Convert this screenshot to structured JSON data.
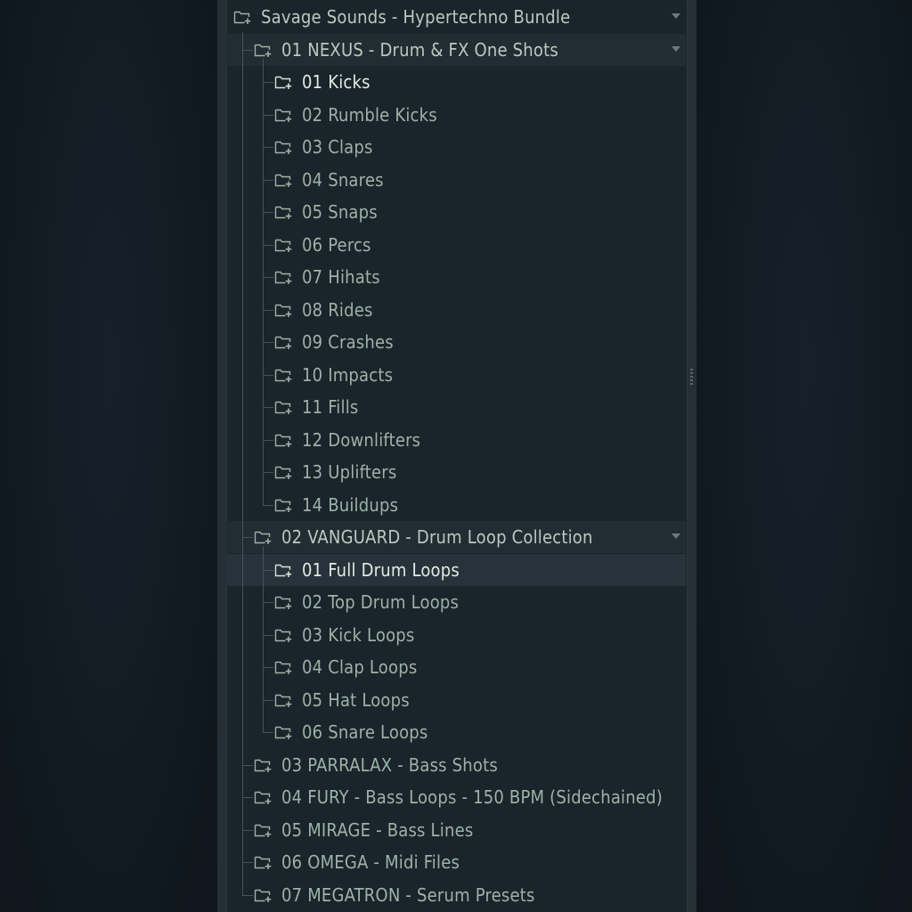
{
  "browser": {
    "root": {
      "label": "Savage Sounds - Hypertechno Bundle",
      "expanded": true
    },
    "groups": [
      {
        "label": "01 NEXUS - Drum & FX One Shots",
        "expanded": true,
        "children": [
          "01 Kicks",
          "02 Rumble Kicks",
          "03 Claps",
          "04 Snares",
          "05 Snaps",
          "06 Percs",
          "07 Hihats",
          "08 Rides",
          "09 Crashes",
          "10 Impacts",
          "11 Fills",
          "12 Downlifters",
          "13 Uplifters",
          "14 Buildups"
        ]
      },
      {
        "label": "02 VANGUARD - Drum Loop Collection",
        "expanded": true,
        "children": [
          "01 Full Drum Loops",
          "02 Top Drum Loops",
          "03 Kick Loops",
          "04 Clap Loops",
          "05 Hat Loops",
          "06 Snare Loops"
        ]
      },
      {
        "label": "03 PARRALAX - Bass Shots",
        "expanded": false,
        "children": []
      },
      {
        "label": "04 FURY - Bass Loops - 150 BPM (Sidechained)",
        "expanded": false,
        "children": []
      },
      {
        "label": "05 MIRAGE - Bass Lines",
        "expanded": false,
        "children": []
      },
      {
        "label": "06 OMEGA - Midi Files",
        "expanded": false,
        "children": []
      },
      {
        "label": "07 MEGATRON - Serum Presets",
        "expanded": false,
        "children": []
      }
    ],
    "selected": "02 VANGUARD - Drum Loop Collection / 01 Full Drum Loops",
    "icons": {
      "folder": "folder-plus-icon",
      "expand": "chevron-down-icon"
    },
    "colors": {
      "panel": "#1a242b",
      "text": "#9cb3a8",
      "text_selected": "#e1ebe4",
      "highlight": "#27323a"
    }
  }
}
